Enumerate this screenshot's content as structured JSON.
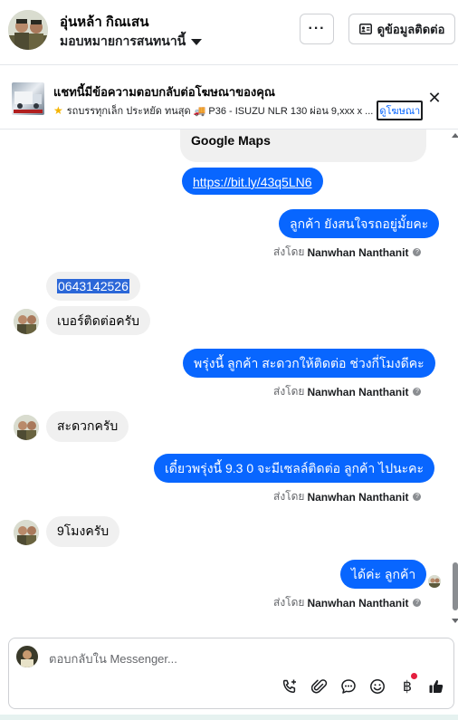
{
  "header": {
    "contact_name": "อุ่นหล้า กิณเสน",
    "assignment_label": "มอบหมายการสนทนานี้",
    "more_label": "···",
    "contact_info_label": "ดูข้อมูลติดต่อ"
  },
  "ad_banner": {
    "title": "แชทนี้มีข้อความตอบกลับต่อโฆษณาของคุณ",
    "subtitle": "รถบรรทุกเล็ก ประหยัด ทนสุด 🚚 P36 - ISUZU NLR 130 ผ่อน 9,xxx x ...",
    "link_label": "ดูโฆษณา"
  },
  "messages": {
    "m1": "Google Maps",
    "m2": "https://bit.ly/43q5LN6",
    "m3": "ลูกค้า ยังสนใจรถอยู่มั้ยคะ",
    "m4": "0643142526",
    "m5": "เบอร์ติดต่อครับ",
    "m6": "พรุ่งนี้ ลูกค้า สะดวกให้ติดต่อ ช่วงกี่โมงดีคะ",
    "m7": "สะดวกครับ",
    "m8": "เดี๋ยวพรุ่งนี้ 9.3 0 จะมีเซลล์ติดต่อ ลูกค้า ไปนะคะ",
    "m9": "9โมงครับ",
    "m10": "ได้ค่ะ  ลูกค้า"
  },
  "sent_by": {
    "prefix": "ส่งโดย",
    "name": "Nanwhan Nanthanit"
  },
  "composer": {
    "placeholder": "ตอบกลับใน Messenger..."
  },
  "icons": {
    "call": "phone-plus-icon",
    "attach": "paperclip-icon",
    "saved_reply": "chat-bubble-icon",
    "emoji": "smiley-icon",
    "payment": "baht-icon",
    "like": "thumbs-up-icon"
  },
  "colors": {
    "outgoing_bubble": "#0866ff",
    "incoming_bubble": "#f0f0f0",
    "notification_dot": "#e41e3f"
  }
}
